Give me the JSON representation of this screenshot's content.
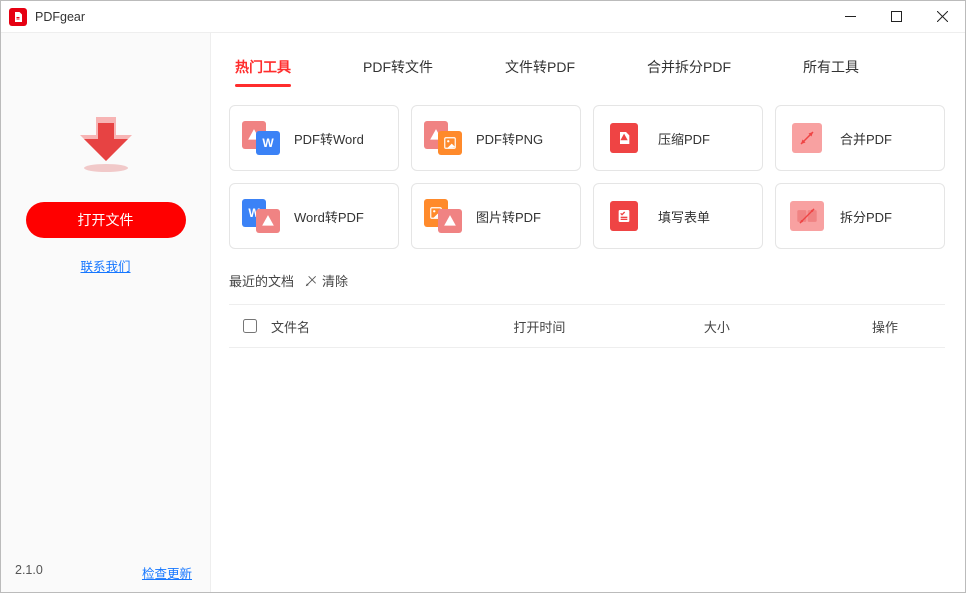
{
  "app": {
    "title": "PDFgear"
  },
  "sidebar": {
    "open_label": "打开文件",
    "contact_label": "联系我们",
    "version": "2.1.0",
    "check_update": "检查更新"
  },
  "tabs": [
    {
      "label": "热门工具",
      "active": true
    },
    {
      "label": "PDF转文件",
      "active": false
    },
    {
      "label": "文件转PDF",
      "active": false
    },
    {
      "label": "合并拆分PDF",
      "active": false
    },
    {
      "label": "所有工具",
      "active": false
    }
  ],
  "tools": {
    "pdf_to_word": "PDF转Word",
    "pdf_to_png": "PDF转PNG",
    "compress_pdf": "压缩PDF",
    "merge_pdf": "合并PDF",
    "word_to_pdf": "Word转PDF",
    "img_to_pdf": "图片转PDF",
    "fill_form": "填写表单",
    "split_pdf": "拆分PDF"
  },
  "recent": {
    "heading": "最近的文档",
    "clear": "清除"
  },
  "table": {
    "col_name": "文件名",
    "col_time": "打开时间",
    "col_size": "大小",
    "col_op": "操作"
  }
}
